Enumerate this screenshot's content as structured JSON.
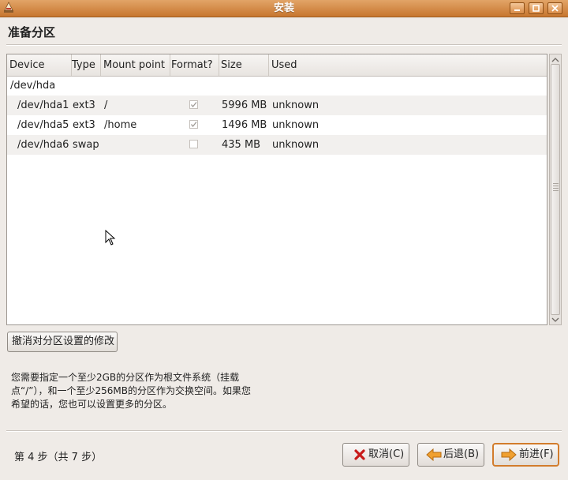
{
  "window": {
    "title": "安装",
    "accent_color": "#d9883f",
    "buttons": [
      "minimize-icon",
      "maximize-icon",
      "close-icon"
    ]
  },
  "page": {
    "heading": "准备分区"
  },
  "table": {
    "columns": [
      "Device",
      "Type",
      "Mount point",
      "Format?",
      "Size",
      "Used"
    ],
    "group": "/dev/hda",
    "rows": [
      {
        "device": "/dev/hda1",
        "type": "ext3",
        "mount": "/",
        "format": true,
        "size": "5996 MB",
        "used": "unknown"
      },
      {
        "device": "/dev/hda5",
        "type": "ext3",
        "mount": "/home",
        "format": true,
        "size": "1496 MB",
        "used": "unknown"
      },
      {
        "device": "/dev/hda6",
        "type": "swap",
        "mount": "",
        "format": false,
        "size": "435 MB",
        "used": "unknown"
      }
    ]
  },
  "actions": {
    "revert_label": "撤消对分区设置的修改"
  },
  "info": {
    "lines": [
      "您需要指定一个至少2GB的分区作为根文件系统（挂载",
      "点“/”），和一个至少256MB的分区作为交换空间。如果您",
      "希望的话，您也可以设置更多的分区。"
    ]
  },
  "footer": {
    "step_text": "第 4 步（共 7 步）",
    "cancel_label": "取消(C)",
    "back_label": "后退(B)",
    "forward_label": "前进(F)"
  }
}
